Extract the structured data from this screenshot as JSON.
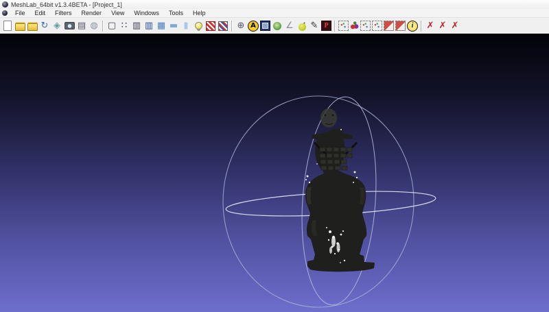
{
  "window": {
    "title": "MeshLab_64bit v1.3.4BETA - [Project_1]"
  },
  "menu": {
    "items": [
      "File",
      "Edit",
      "Filters",
      "Render",
      "View",
      "Windows",
      "Tools",
      "Help"
    ]
  },
  "toolbar": {
    "groups": [
      {
        "name": "file-group",
        "icons": [
          {
            "name": "new-project-icon",
            "kind": "page"
          },
          {
            "name": "open-project-icon",
            "kind": "folder"
          },
          {
            "name": "import-mesh-icon",
            "kind": "folder"
          },
          {
            "name": "reload-mesh-icon",
            "kind": "glyph",
            "glyph": "↻",
            "color": "#3a6ea5"
          },
          {
            "name": "export-mesh-icon",
            "kind": "glyph",
            "glyph": "◈",
            "color": "#5f9aa0"
          },
          {
            "name": "snapshot-icon",
            "kind": "camera"
          },
          {
            "name": "show-layers-icon",
            "kind": "glyph",
            "glyph": "▤",
            "color": "#556"
          },
          {
            "name": "open-web-icon",
            "kind": "glyph",
            "glyph": "◍",
            "color": "#8a90a8"
          }
        ]
      },
      {
        "name": "render-mode-group",
        "icons": [
          {
            "name": "bounding-box-render-icon",
            "kind": "glyph",
            "glyph": "▢",
            "color": "#445"
          },
          {
            "name": "points-render-icon",
            "kind": "glyph",
            "glyph": "∷",
            "color": "#334"
          },
          {
            "name": "wireframe-render-icon",
            "kind": "glyph",
            "glyph": "▥",
            "color": "#445"
          },
          {
            "name": "hidden-lines-render-icon",
            "kind": "glyph",
            "glyph": "▥",
            "color": "#2a4f9e"
          },
          {
            "name": "flat-lines-render-icon",
            "kind": "glyph",
            "glyph": "▦",
            "color": "#4a7fc0"
          },
          {
            "name": "flat-render-icon",
            "kind": "glyph",
            "glyph": "▬",
            "color": "#7fa8d8"
          },
          {
            "name": "smooth-render-icon",
            "kind": "glyph",
            "glyph": "▮",
            "color": "#a8c8e8"
          },
          {
            "name": "light-toggle-icon",
            "kind": "bulb"
          },
          {
            "name": "texture-toggle-icon",
            "kind": "wedge-red"
          },
          {
            "name": "decoration-toggle-icon",
            "kind": "wedge-stripe"
          }
        ]
      },
      {
        "name": "tools-group",
        "icons": [
          {
            "name": "trackball-icon",
            "kind": "glyph",
            "glyph": "⊕",
            "color": "#556"
          },
          {
            "name": "show-axis-icon",
            "kind": "circle-a",
            "glyph": "A"
          },
          {
            "name": "layer-dialog-icon",
            "kind": "square-blue"
          },
          {
            "name": "quality-mapper-icon",
            "kind": "blob-green"
          },
          {
            "name": "measure-tool-icon",
            "kind": "glyph",
            "glyph": "∠",
            "color": "#8a8a9a"
          },
          {
            "name": "point-picker-icon",
            "kind": "apple"
          },
          {
            "name": "paint-tool-icon",
            "kind": "glyph",
            "glyph": "✎",
            "color": "#333"
          },
          {
            "name": "pickpoints-icon",
            "kind": "letter-p",
            "glyph": "P"
          }
        ]
      },
      {
        "name": "selection-group",
        "icons": [
          {
            "name": "select-vertices-icon",
            "kind": "dash-box"
          },
          {
            "name": "select-connected-icon",
            "kind": "cherries"
          },
          {
            "name": "select-faces-icon",
            "kind": "dash-box"
          },
          {
            "name": "move-selection-icon",
            "kind": "dash-box"
          },
          {
            "name": "select-face-rect-icon",
            "kind": "dash-box-red"
          },
          {
            "name": "deselect-face-rect-icon",
            "kind": "dash-box-red"
          },
          {
            "name": "info-icon",
            "kind": "circle-i",
            "glyph": "i"
          }
        ]
      },
      {
        "name": "delete-group",
        "icons": [
          {
            "name": "delete-selected-vertices-icon",
            "kind": "glyph",
            "glyph": "✗",
            "color": "#c22222"
          },
          {
            "name": "delete-selected-faces-icon",
            "kind": "glyph",
            "glyph": "✗",
            "color": "#c22222"
          },
          {
            "name": "delete-faces-vertices-icon",
            "kind": "glyph",
            "glyph": "✗",
            "color": "#c22222"
          }
        ]
      }
    ]
  },
  "viewport": {
    "bg_stops": [
      "#030308",
      "#15152e",
      "#32326a",
      "#5252a2",
      "#6e6ecd"
    ],
    "trackball": {
      "outer_color": "#aab3d6",
      "meridian_color": "#b6bedd",
      "equator_color": "#dfe4f7"
    },
    "model": {
      "label": "terracotta-warrior-mesh",
      "color": "#1f1f1d",
      "speckle_color": "#eeeeee"
    }
  }
}
